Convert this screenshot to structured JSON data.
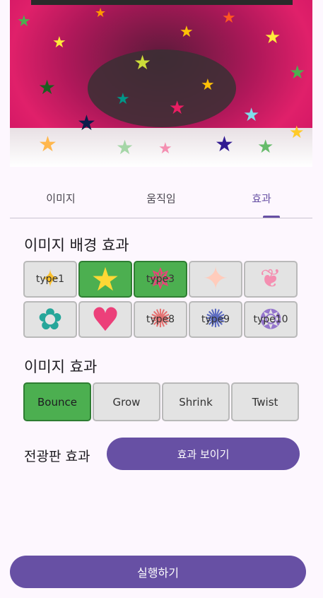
{
  "preview": {
    "icon": "star-animation-preview"
  },
  "tabs": [
    {
      "label": "이미지"
    },
    {
      "label": "움직임"
    },
    {
      "label": "효과"
    }
  ],
  "background_effects": {
    "title": "이미지 배경 효과",
    "items": [
      {
        "label": "type1",
        "icon": "sparkle-star"
      },
      {
        "label": "",
        "icon": "smiling-star"
      },
      {
        "label": "type3",
        "icon": "burst-star"
      },
      {
        "label": "",
        "icon": "four-point-star"
      },
      {
        "label": "",
        "icon": "butterfly"
      },
      {
        "label": "",
        "icon": "flower"
      },
      {
        "label": "",
        "icon": "heart"
      },
      {
        "label": "type8",
        "icon": "firework"
      },
      {
        "label": "type9",
        "icon": "firework"
      },
      {
        "label": "type10",
        "icon": "swirl"
      }
    ],
    "selected": [
      "smiling-star",
      "burst-star"
    ]
  },
  "image_effects": {
    "title": "이미지 효과",
    "buttons": [
      {
        "label": "Bounce"
      },
      {
        "label": "Grow"
      },
      {
        "label": "Shrink"
      },
      {
        "label": "Twist"
      }
    ],
    "selected": "Bounce"
  },
  "billboard": {
    "label": "전광판 효과",
    "button_label": "효과 보이기"
  },
  "run_button": {
    "label": "실행하기"
  },
  "colors": {
    "accent": "#6750a4",
    "selected": "#4caf50",
    "background": "#fdf7fe"
  }
}
